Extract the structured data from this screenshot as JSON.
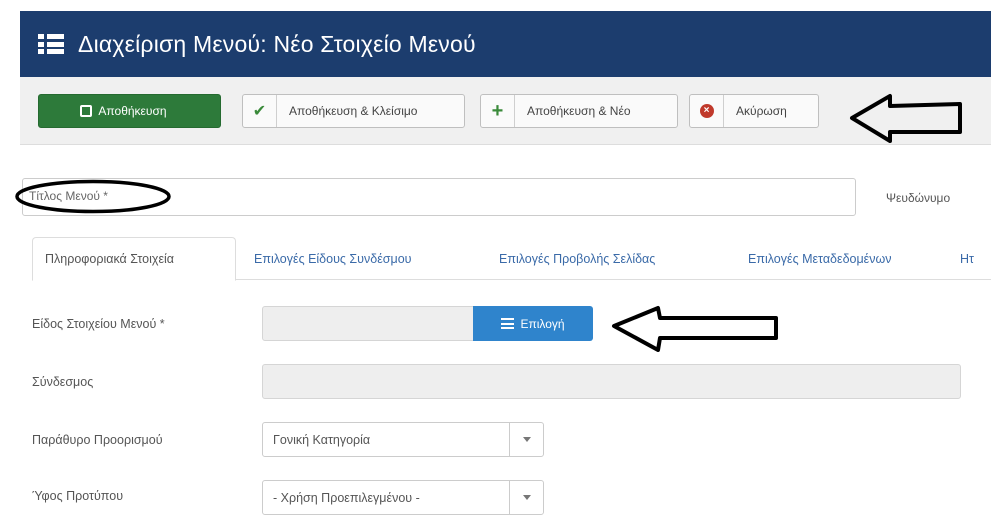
{
  "header": {
    "title": "Διαχείριση Μενού: Νέο Στοιχείο Μενού",
    "icon": "list-icon"
  },
  "toolbar": {
    "save_label": "Αποθήκευση",
    "save_close_label": "Αποθήκευση & Κλείσιμο",
    "save_new_label": "Αποθήκευση & Νέο",
    "cancel_label": "Ακύρωση"
  },
  "form": {
    "title_placeholder": "Τίτλος Μενού *",
    "alias_label": "Ψευδώνυμο"
  },
  "tabs": [
    {
      "label": "Πληροφοριακά Στοιχεία"
    },
    {
      "label": "Επιλογές Είδους Συνδέσμου"
    },
    {
      "label": "Επιλογές Προβολής Σελίδας"
    },
    {
      "label": "Επιλογές Μεταδεδομένων"
    },
    {
      "label": "Ητ"
    }
  ],
  "fields": {
    "menu_item_type_label": "Είδος Στοιχείου Μενού *",
    "select_button_label": "Επιλογή",
    "link_label": "Σύνδεσμος",
    "target_window_label": "Παράθυρο Προορισμού",
    "target_window_value": "Γονική Κατηγορία",
    "template_style_label": "Ύφος Προτύπου",
    "template_style_value": "- Χρήση Προεπιλεγμένου -"
  },
  "colors": {
    "header_bg": "#1c3d6e",
    "save_button": "#2d7a3a",
    "select_button": "#2f84cc"
  }
}
